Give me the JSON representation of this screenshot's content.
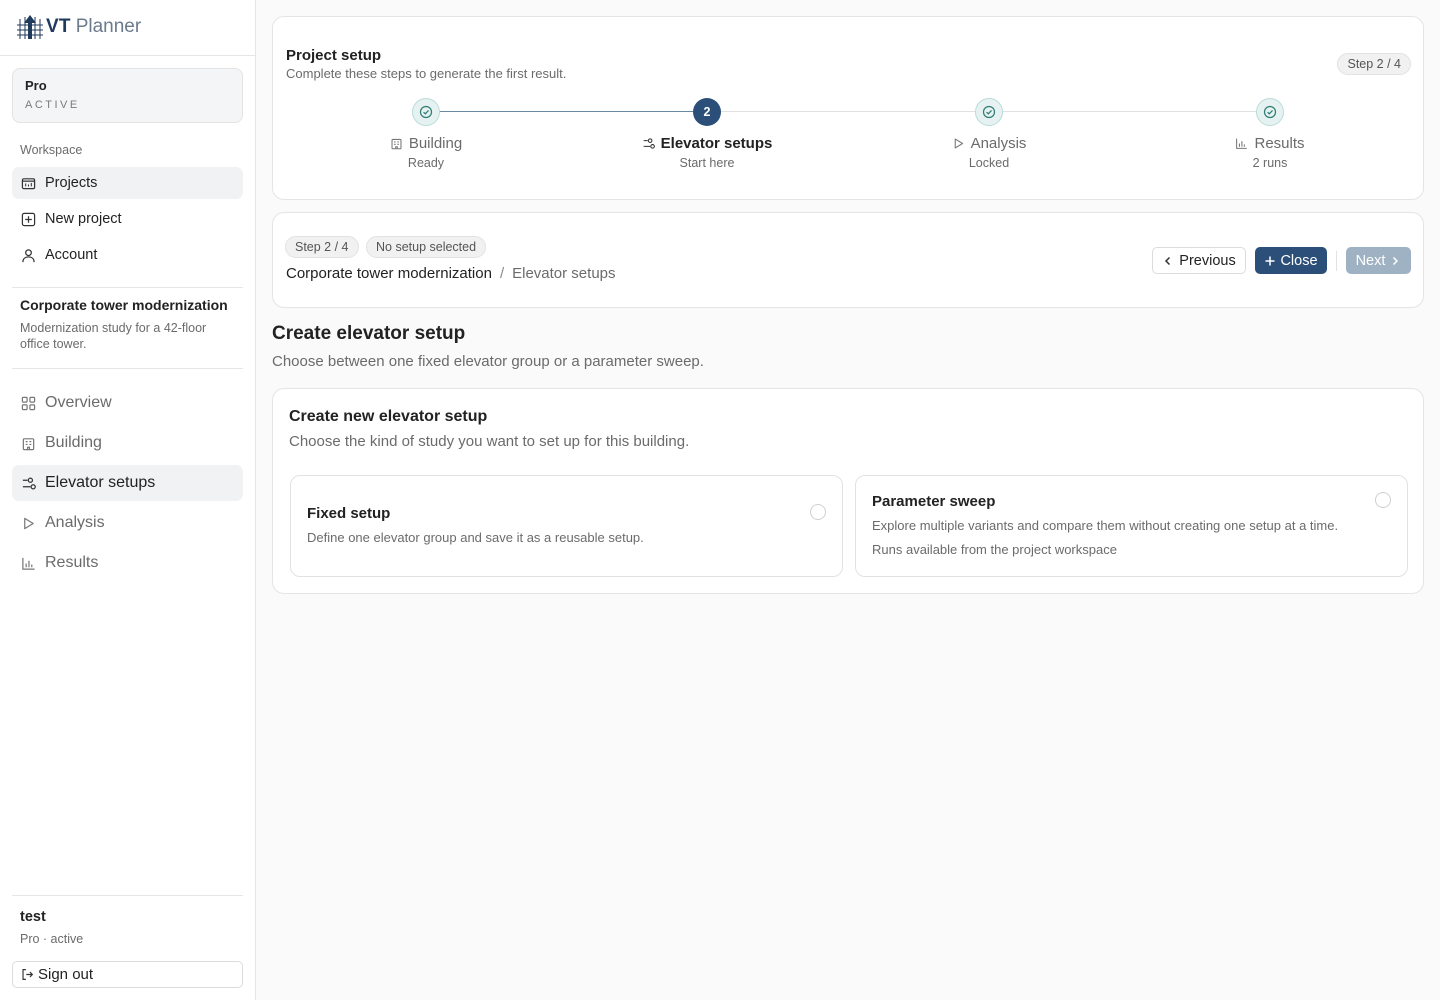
{
  "brand": {
    "vt": "VT",
    "planner": "Planner"
  },
  "plan": {
    "name": "Pro",
    "status": "ACTIVE"
  },
  "workspace": {
    "label": "Workspace",
    "items": [
      {
        "label": "Projects",
        "icon": "folder-icon"
      },
      {
        "label": "New project",
        "icon": "plus-square-icon"
      },
      {
        "label": "Account",
        "icon": "user-icon"
      }
    ]
  },
  "project": {
    "title": "Corporate tower modernization",
    "description": "Modernization study for a 42-floor office tower.",
    "nav": [
      {
        "label": "Overview",
        "icon": "grid-icon"
      },
      {
        "label": "Building",
        "icon": "building-icon"
      },
      {
        "label": "Elevator setups",
        "icon": "sliders-icon"
      },
      {
        "label": "Analysis",
        "icon": "play-icon"
      },
      {
        "label": "Results",
        "icon": "bar-chart-icon"
      }
    ]
  },
  "user": {
    "name": "test",
    "plan": "Pro · active",
    "signout": "Sign out"
  },
  "setup": {
    "title": "Project setup",
    "subtitle": "Complete these steps to generate the first result.",
    "step_pill": "Step 2 / 4",
    "progress_fraction": 0.333,
    "steps": [
      {
        "label": "Building",
        "status": "Ready",
        "state": "done",
        "icon": "building-icon"
      },
      {
        "label": "Elevator setups",
        "status": "Start here",
        "state": "current",
        "number": "2",
        "icon": "sliders-icon"
      },
      {
        "label": "Analysis",
        "status": "Locked",
        "state": "done",
        "icon": "play-icon"
      },
      {
        "label": "Results",
        "status": "2 runs",
        "state": "done",
        "icon": "bar-chart-icon"
      }
    ]
  },
  "navbar": {
    "step_pill": "Step 2 / 4",
    "selection_pill": "No setup selected",
    "breadcrumb_project": "Corporate tower modernization",
    "breadcrumb_sep": "/",
    "breadcrumb_current": "Elevator setups",
    "previous_label": "Previous",
    "close_label": "Close",
    "next_label": "Next"
  },
  "page": {
    "title": "Create elevator setup",
    "subtitle": "Choose between one fixed elevator group or a parameter sweep."
  },
  "create": {
    "title": "Create new elevator setup",
    "subtitle": "Choose the kind of study you want to set up for this building.",
    "options": [
      {
        "title": "Fixed setup",
        "description": "Define one elevator group and save it as a reusable setup.",
        "note": ""
      },
      {
        "title": "Parameter sweep",
        "description": "Explore multiple variants and compare them without creating one setup at a time.",
        "note": "Runs available from the project workspace"
      }
    ]
  },
  "colors": {
    "accent": "#2b4f78",
    "done_fill": "#e5f2f1",
    "done_check": "#2f7d74",
    "disabled": "#9fb2c4"
  }
}
